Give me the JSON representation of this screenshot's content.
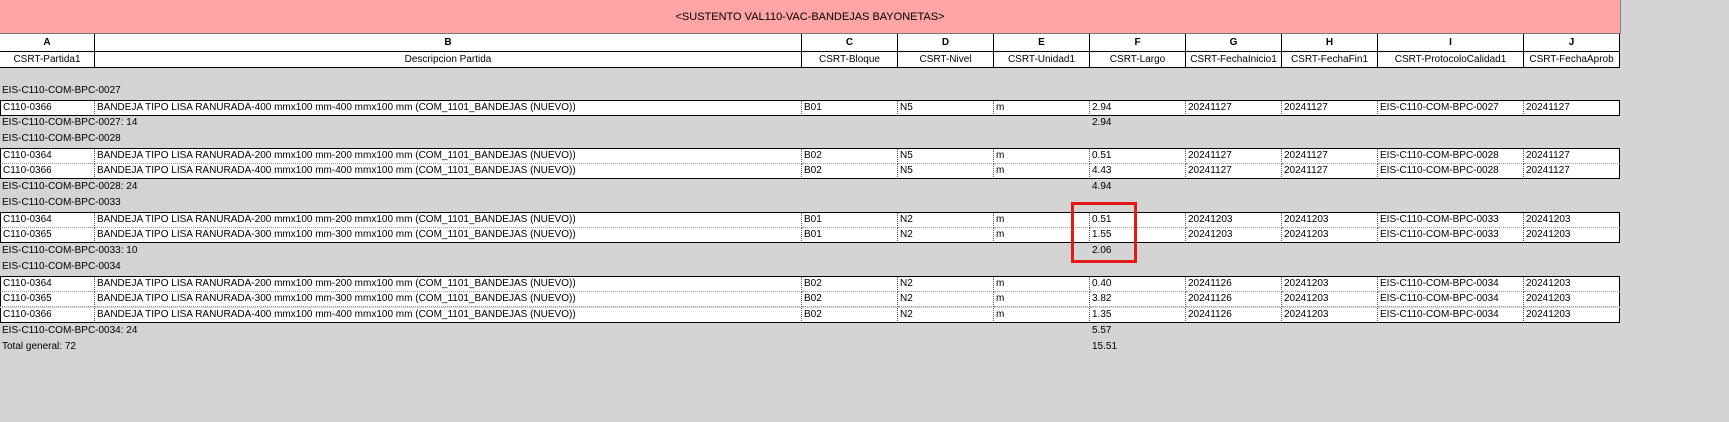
{
  "title": "<SUSTENTO VAL110-VAC-BANDEJAS BAYONETAS>",
  "column_letters": [
    "A",
    "B",
    "C",
    "D",
    "E",
    "F",
    "G",
    "H",
    "I",
    "J"
  ],
  "column_headers": [
    "CSRT-Partida1",
    "Descripcion Partida",
    "CSRT-Bloque",
    "CSRT-Nivel",
    "CSRT-Unidad1",
    "CSRT-Largo",
    "CSRT-FechaInicio1",
    "CSRT-FechaFin1",
    "CSRT-ProtocoloCalidad1",
    "CSRT-FechaAprob"
  ],
  "groups": [
    {
      "label": "EIS-C110-COM-BPC-0027",
      "rows": [
        [
          "C110-0366",
          "BANDEJA TIPO LISA RANURADA-400 mmx100 mm-400 mmx100 mm (COM_1101_BANDEJAS (NUEVO))",
          "B01",
          "N5",
          "m",
          "2.94",
          "20241127",
          "20241127",
          "EIS-C110-COM-BPC-0027",
          "20241127"
        ]
      ],
      "subtotal_label": "EIS-C110-COM-BPC-0027: 14",
      "subtotal_value": "2.94"
    },
    {
      "label": "EIS-C110-COM-BPC-0028",
      "rows": [
        [
          "C110-0364",
          "BANDEJA TIPO LISA RANURADA-200 mmx100 mm-200 mmx100 mm (COM_1101_BANDEJAS (NUEVO))",
          "B02",
          "N5",
          "m",
          "0.51",
          "20241127",
          "20241127",
          "EIS-C110-COM-BPC-0028",
          "20241127"
        ],
        [
          "C110-0366",
          "BANDEJA TIPO LISA RANURADA-400 mmx100 mm-400 mmx100 mm (COM_1101_BANDEJAS (NUEVO))",
          "B02",
          "N5",
          "m",
          "4.43",
          "20241127",
          "20241127",
          "EIS-C110-COM-BPC-0028",
          "20241127"
        ]
      ],
      "subtotal_label": "EIS-C110-COM-BPC-0028: 24",
      "subtotal_value": "4.94"
    },
    {
      "label": "EIS-C110-COM-BPC-0033",
      "rows": [
        [
          "C110-0364",
          "BANDEJA TIPO LISA RANURADA-200 mmx100 mm-200 mmx100 mm (COM_1101_BANDEJAS (NUEVO))",
          "B01",
          "N2",
          "m",
          "0.51",
          "20241203",
          "20241203",
          "EIS-C110-COM-BPC-0033",
          "20241203"
        ],
        [
          "C110-0365",
          "BANDEJA TIPO LISA RANURADA-300 mmx100 mm-300 mmx100 mm (COM_1101_BANDEJAS (NUEVO))",
          "B01",
          "N2",
          "m",
          "1.55",
          "20241203",
          "20241203",
          "EIS-C110-COM-BPC-0033",
          "20241203"
        ]
      ],
      "subtotal_label": "EIS-C110-COM-BPC-0033: 10",
      "subtotal_value": "2.06"
    },
    {
      "label": "EIS-C110-COM-BPC-0034",
      "rows": [
        [
          "C110-0364",
          "BANDEJA TIPO LISA RANURADA-200 mmx100 mm-200 mmx100 mm (COM_1101_BANDEJAS (NUEVO))",
          "B02",
          "N2",
          "m",
          "0.40",
          "20241126",
          "20241203",
          "EIS-C110-COM-BPC-0034",
          "20241203"
        ],
        [
          "C110-0365",
          "BANDEJA TIPO LISA RANURADA-300 mmx100 mm-300 mmx100 mm (COM_1101_BANDEJAS (NUEVO))",
          "B02",
          "N2",
          "m",
          "3.82",
          "20241126",
          "20241203",
          "EIS-C110-COM-BPC-0034",
          "20241203"
        ],
        [
          "C110-0366",
          "BANDEJA TIPO LISA RANURADA-400 mmx100 mm-400 mmx100 mm (COM_1101_BANDEJAS (NUEVO))",
          "B02",
          "N2",
          "m",
          "1.35",
          "20241126",
          "20241203",
          "EIS-C110-COM-BPC-0034",
          "20241203"
        ]
      ],
      "subtotal_label": "EIS-C110-COM-BPC-0034: 24",
      "subtotal_value": "5.57"
    }
  ],
  "grand_total_label": "Total general: 72",
  "grand_total_value": "15.51",
  "colors": {
    "title_bg": "#ffa5a5",
    "highlight": "#e21a1a",
    "sheet_bg": "#d4d4d4"
  }
}
